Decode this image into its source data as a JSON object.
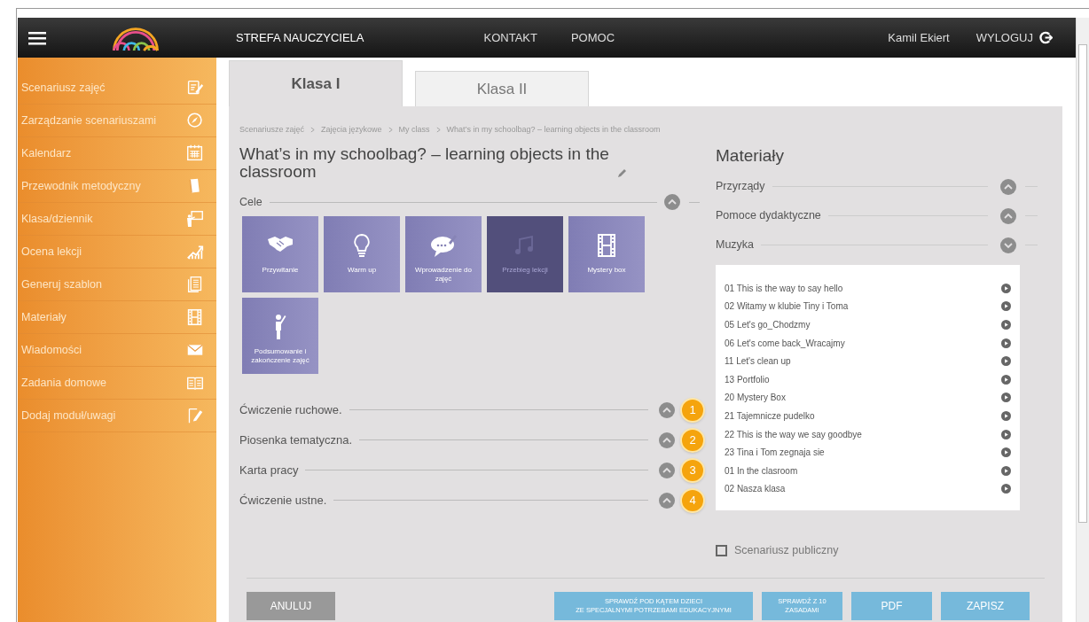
{
  "topbar": {
    "menu": "STREFA NAUCZYCIELA",
    "links": [
      "KONTAKT",
      "POMOC"
    ],
    "user": "Kamil Ekiert",
    "logout": "WYLOGUJ"
  },
  "sidebar": {
    "items": [
      {
        "label": "Scenariusz zajęć"
      },
      {
        "label": "Zarządzanie scenariuszami"
      },
      {
        "label": "Kalendarz"
      },
      {
        "label": "Przewodnik metodyczny"
      },
      {
        "label": "Klasa/dziennik"
      },
      {
        "label": "Ocena lekcji"
      },
      {
        "label": "Generuj szablon"
      },
      {
        "label": "Materiały"
      },
      {
        "label": "Wiadomości"
      },
      {
        "label": "Zadania domowe"
      },
      {
        "label": "Dodaj moduł/uwagi"
      }
    ]
  },
  "tabs": [
    {
      "label": "Klasa I",
      "selected": true
    },
    {
      "label": "Klasa II",
      "selected": false
    }
  ],
  "breadcrumb": [
    "Scenariusze zajęć",
    "Zajęcia językowe",
    "My class",
    "What’s in my schoolbag? – learning objects in the classroom"
  ],
  "title": "What’s in my schoolbag? – learning objects in the classroom",
  "goals": {
    "label": "Cele",
    "tiles": [
      {
        "label": "Przywitanie",
        "dimmed": false
      },
      {
        "label": "Warm up",
        "dimmed": false
      },
      {
        "label": "Wprowadzenie do zajęć",
        "dimmed": false
      },
      {
        "label": "Przebieg lekcji",
        "dimmed": true
      },
      {
        "label": "Mystery box",
        "dimmed": false
      },
      {
        "label": "Podsumowanie i zakończenie zajęć",
        "dimmed": false
      }
    ]
  },
  "sections": [
    {
      "label": "Ćwiczenie ruchowe.",
      "badge": "1"
    },
    {
      "label": "Piosenka tematyczna.",
      "badge": "2"
    },
    {
      "label": "Karta pracy",
      "badge": "3"
    },
    {
      "label": "Ćwiczenie ustne.",
      "badge": "4"
    }
  ],
  "materials": {
    "title": "Materiały",
    "groups": [
      {
        "label": "Przyrządy",
        "expanded": false
      },
      {
        "label": "Pomoce dydaktyczne",
        "expanded": false
      },
      {
        "label": "Muzyka",
        "expanded": true
      }
    ],
    "tracks": [
      "01 This is the way to say hello",
      "02 Witamy w klubie Tiny i Toma",
      "05 Let's go_Chodzmy",
      "06 Let's come back_Wracajmy",
      "11 Let's clean up",
      "13 Portfolio",
      "20 Mystery Box",
      "21 Tajemnicze pudelko",
      "22 This is the way we say goodbye",
      "23 Tina i Tom zegnaja sie",
      "01 In the clasroom",
      "02 Nasza klasa"
    ]
  },
  "public": {
    "label": "Scenariusz publiczny",
    "checked": false
  },
  "buttons": {
    "cancel": "ANULUJ",
    "actions": [
      "SPRAWDŹ POD KĄTEM DZIECI\nZE SPECJALNYMI POTRZEBAMI EDUKACYJNYMI",
      "SPRAWDŹ Z 10\nZASADAMI",
      "PDF",
      "ZAPISZ"
    ]
  }
}
